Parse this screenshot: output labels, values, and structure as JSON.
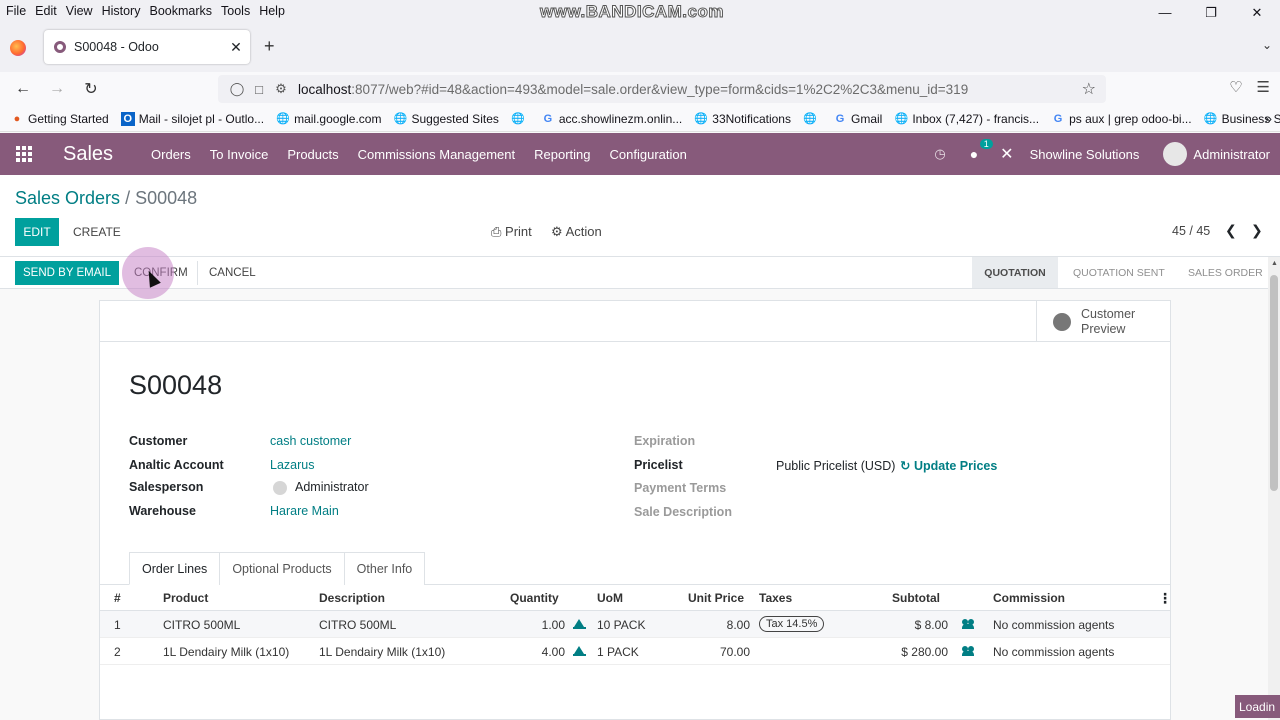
{
  "browser": {
    "menu": [
      "File",
      "Edit",
      "View",
      "History",
      "Bookmarks",
      "Tools",
      "Help"
    ],
    "watermark": "www.BANDICAM.com",
    "tab_title": "S00048 - Odoo",
    "url_host": "localhost",
    "url_rest": ":8077/web?#id=48&action=493&model=sale.order&view_type=form&cids=1%2C2%2C3&menu_id=319",
    "bookmarks": [
      "Getting Started",
      "Mail - silojet pl - Outlo...",
      "mail.google.com",
      "Suggested Sites",
      "",
      "acc.showlinezm.onlin...",
      "33Notifications",
      "",
      "Gmail",
      "Inbox (7,427) - francis...",
      "ps aux | grep odoo-bi...",
      "Business Suite"
    ]
  },
  "odoo_nav": {
    "app_name": "Sales",
    "menu": [
      "Orders",
      "To Invoice",
      "Products",
      "Commissions Management",
      "Reporting",
      "Configuration"
    ],
    "chat_count": "1",
    "company": "Showline Solutions",
    "user": "Administrator"
  },
  "control_panel": {
    "breadcrumb_parent": "Sales Orders",
    "breadcrumb_sep": "/",
    "breadcrumb_current": "S00048",
    "edit": "EDIT",
    "create": "CREATE",
    "print": "Print",
    "action": "Action",
    "pager": "45 / 45"
  },
  "statusbar": {
    "send_email": "SEND BY EMAIL",
    "confirm": "CONFIRM",
    "cancel": "CANCEL",
    "stages": [
      "QUOTATION",
      "QUOTATION SENT",
      "SALES ORDER"
    ],
    "active_stage": "QUOTATION"
  },
  "sheet": {
    "customer_preview": "Customer Preview",
    "order_name": "S00048",
    "left_fields": [
      {
        "label": "Customer",
        "value": "cash customer"
      },
      {
        "label": "Analtic Account",
        "value": "Lazarus"
      },
      {
        "label": "Salesperson",
        "value": "Administrator"
      },
      {
        "label": "Warehouse",
        "value": "Harare Main"
      }
    ],
    "right_fields": [
      {
        "label": "Expiration",
        "value": ""
      },
      {
        "label": "Pricelist",
        "value": "Public Pricelist (USD)"
      },
      {
        "label": "Payment Terms",
        "value": ""
      },
      {
        "label": "Sale Description",
        "value": ""
      }
    ],
    "update_prices": "Update Prices",
    "tabs": [
      "Order Lines",
      "Optional Products",
      "Other Info"
    ],
    "columns": [
      "#",
      "Product",
      "Description",
      "Quantity",
      "UoM",
      "Unit Price",
      "Taxes",
      "Subtotal",
      "Commission"
    ],
    "rows": [
      {
        "num": "1",
        "product": "CITRO 500ML",
        "description": "CITRO 500ML",
        "quantity": "1.00",
        "uom": "10 PACK",
        "unit_price": "8.00",
        "taxes": "Tax 14.5%",
        "subtotal": "$ 8.00",
        "commission": "No commission agents"
      },
      {
        "num": "2",
        "product": "1L Dendairy Milk (1x10)",
        "description": "1L Dendairy Milk (1x10)",
        "quantity": "4.00",
        "uom": "1 PACK",
        "unit_price": "70.00",
        "taxes": "",
        "subtotal": "$ 280.00",
        "commission": "No commission agents"
      }
    ]
  },
  "loading": "Loadin"
}
